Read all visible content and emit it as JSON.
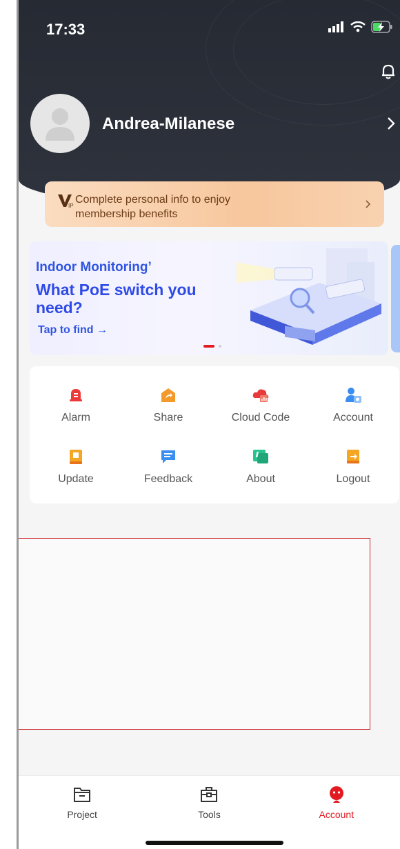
{
  "status_bar": {
    "time": "17:33"
  },
  "profile": {
    "name": "Andrea-Milanese"
  },
  "vip": {
    "text": "Complete personal info to enjoy membership benefits"
  },
  "banner": {
    "line1": "Indoor Monitoring’",
    "line2": "What PoE switch you need?",
    "cta": "Tap to find →"
  },
  "menu": {
    "items": [
      {
        "label": "Alarm",
        "icon": "alarm-icon",
        "color": "#ea3a3a"
      },
      {
        "label": "Share",
        "icon": "share-icon",
        "color": "#f39a2b"
      },
      {
        "label": "Cloud Code",
        "icon": "cloud-code-icon",
        "color": "#e83a3a"
      },
      {
        "label": "Account",
        "icon": "account-icon",
        "color": "#3a8ef0"
      },
      {
        "label": "Update",
        "icon": "update-icon",
        "color": "#f5a623"
      },
      {
        "label": "Feedback",
        "icon": "feedback-icon",
        "color": "#3a8ef0"
      },
      {
        "label": "About",
        "icon": "about-icon",
        "color": "#27c48f"
      },
      {
        "label": "Logout",
        "icon": "logout-icon",
        "color": "#f5a623"
      }
    ]
  },
  "tabs": [
    {
      "label": "Project",
      "icon": "folder-icon"
    },
    {
      "label": "Tools",
      "icon": "toolbox-icon"
    },
    {
      "label": "Account",
      "icon": "account-avatar-icon",
      "active": true
    }
  ],
  "colors": {
    "accent": "#e21b22",
    "header_bg": "#2a2e37",
    "banner_text": "#2f4be6"
  }
}
